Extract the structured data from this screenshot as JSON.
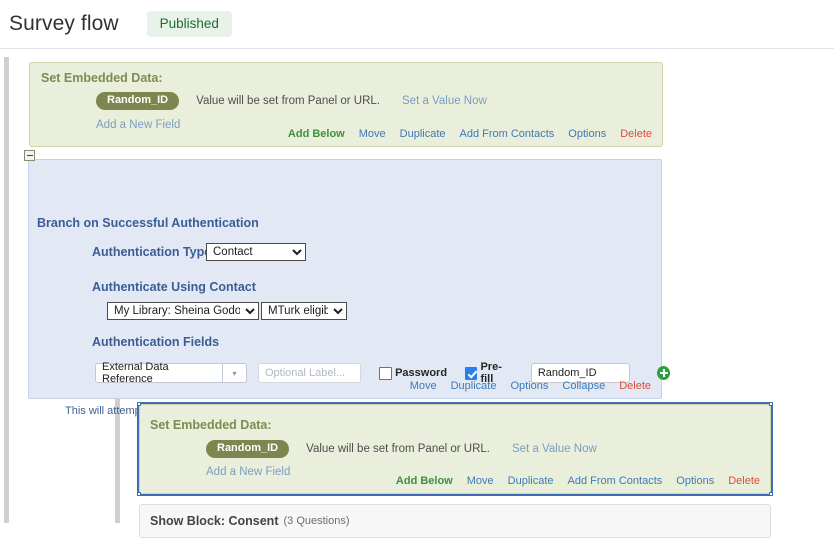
{
  "header": {
    "title": "Survey flow",
    "status_badge": "Published"
  },
  "embedded_data_block_1": {
    "title": "Set Embedded Data:",
    "field_name": "Random_ID",
    "value_text": "Value will be set from Panel or URL.",
    "set_value_link": "Set a Value Now",
    "add_field_link": "Add a New Field",
    "actions": {
      "add_below": "Add Below",
      "move": "Move",
      "duplicate": "Duplicate",
      "add_from_contacts": "Add From Contacts",
      "options": "Options",
      "delete": "Delete"
    }
  },
  "branch": {
    "title": "Branch on Successful Authentication",
    "auth_type_label": "Authentication Type:",
    "auth_type_value": "Contact",
    "auth_using_label": "Authenticate Using Contact",
    "library_value": "My Library: Sheina Godovich",
    "list_value": "MTurk eligibility",
    "auth_fields_label": "Authentication Fields",
    "field_type_value": "External Data Reference",
    "optional_label_placeholder": "Optional Label...",
    "password_label": "Password",
    "prefill_label": "Pre-fill",
    "prefill_value": "Random_ID",
    "note": "This will attempt to automatically authenticate the recipient.",
    "actions": {
      "move": "Move",
      "duplicate": "Duplicate",
      "options": "Options",
      "collapse": "Collapse",
      "delete": "Delete"
    }
  },
  "embedded_data_block_2": {
    "title": "Set Embedded Data:",
    "field_name": "Random_ID",
    "value_text": "Value will be set from Panel or URL.",
    "set_value_link": "Set a Value Now",
    "add_field_link": "Add a New Field",
    "actions": {
      "add_below": "Add Below",
      "move": "Move",
      "duplicate": "Duplicate",
      "add_from_contacts": "Add From Contacts",
      "options": "Options",
      "delete": "Delete"
    }
  },
  "show_block": {
    "title": "Show Block: Consent",
    "count": "(3 Questions)"
  },
  "colors": {
    "embedded_bg": "#eaefdb",
    "embedded_accent": "#7d864e",
    "branch_bg": "#e3e9f4",
    "branch_accent": "#3a5d96",
    "selection": "#3c6db5",
    "link_blue": "#3d7ab8",
    "link_green": "#3f8f3f",
    "link_red": "#e04b3a",
    "checkbox_checked": "#2a7ef0",
    "add_button_green": "#2aa13a"
  }
}
